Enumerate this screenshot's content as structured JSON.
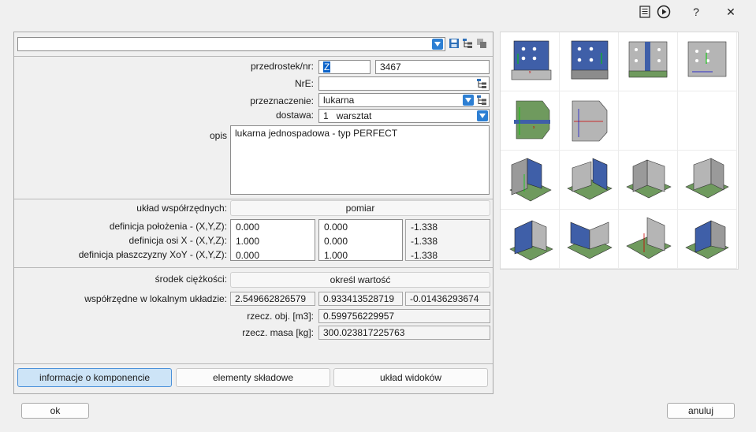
{
  "titlebar": {
    "help_label": "?",
    "close_label": "✕"
  },
  "top": {
    "combo_value": ""
  },
  "component": {
    "prefix_label": "przedrostek/nr:",
    "prefix_value": "Z",
    "number_value": "3467",
    "nre_label": "NrE:",
    "nre_value": "",
    "purpose_label": "przeznaczenie:",
    "purpose_value": "lukarna",
    "delivery_label": "dostawa:",
    "delivery_num": "1",
    "delivery_value": "warsztat",
    "desc_label": "opis",
    "desc_value": "lukarna jednospadowa - typ PERFECT"
  },
  "coords": {
    "system_label": "układ współrzędnych:",
    "system_button": "pomiar",
    "rows": [
      {
        "label": "definicja położenia - (X,Y,Z):",
        "x": "0.000",
        "y": "0.000",
        "z": "-1.338"
      },
      {
        "label": "definicja osi X - (X,Y,Z):",
        "x": "1.000",
        "y": "0.000",
        "z": "-1.338"
      },
      {
        "label": "definicja płaszczyzny XoY - (X,Y,Z):",
        "x": "0.000",
        "y": "1.000",
        "z": "-1.338"
      }
    ]
  },
  "mass": {
    "center_label": "środek ciężkości:",
    "center_button": "określ wartość",
    "local_label": "współrzędne w lokalnym układzie:",
    "local_x": "2.549662826579",
    "local_y": "0.933413528719",
    "local_z": "-0.01436293674",
    "volume_label": "rzecz. obj. [m3]:",
    "volume_value": "0.599756229957",
    "weight_label": "rzecz. masa [kg]:",
    "weight_value": "300.023817225763"
  },
  "tabs": [
    {
      "label": "informacje o komponencie",
      "active": true
    },
    {
      "label": "elementy składowe",
      "active": false
    },
    {
      "label": "układ widoków",
      "active": false
    }
  ],
  "footer": {
    "ok_label": "ok",
    "cancel_label": "anuluj"
  },
  "colors": {
    "accent": "#4a90d9",
    "plate_blue": "#3f5fa8",
    "plate_green": "#6f9a5e",
    "plate_gray": "#8c8c8c"
  }
}
